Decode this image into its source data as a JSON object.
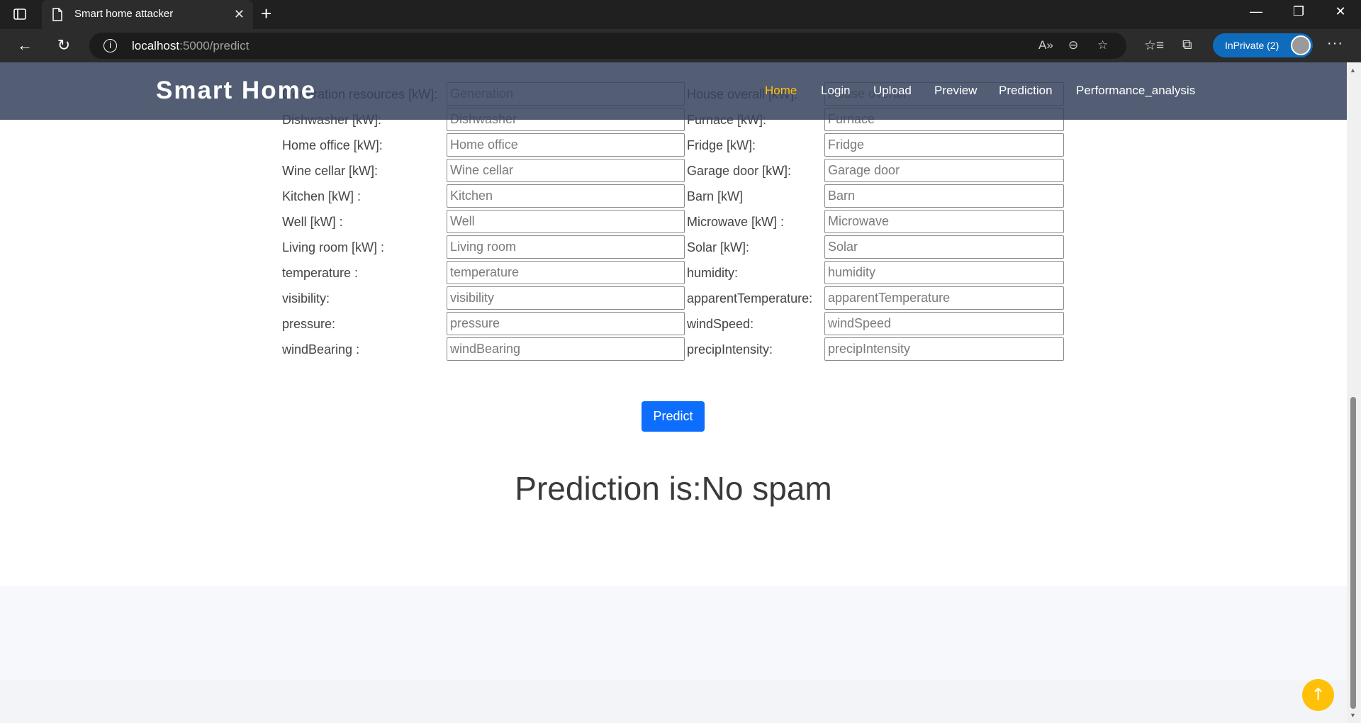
{
  "browser": {
    "tab_title": "Smart home attacker",
    "tab_close": "✕",
    "new_tab": "+",
    "url_host": "localhost",
    "url_path": ":5000/predict",
    "inprivate_label": "InPrivate (2)",
    "more": "···",
    "window_controls": [
      "—",
      "❐",
      "✕"
    ]
  },
  "navbar": {
    "brand": "Smart Home",
    "links": [
      "Home",
      "Login",
      "Upload",
      "Preview",
      "Prediction",
      "Performance_analysis"
    ],
    "active_link": "Home"
  },
  "form": {
    "rows": [
      {
        "left_label": "Generation resources [kW]:",
        "left_placeholder": "Generation",
        "right_label": "House overall [kW]:",
        "right_placeholder": "House overall"
      },
      {
        "left_label": "Dishwasher [kW]:",
        "left_placeholder": "Dishwasher",
        "right_label": "Furnace [kW]:",
        "right_placeholder": "Furnace"
      },
      {
        "left_label": "Home office [kW]:",
        "left_placeholder": "Home office",
        "right_label": "Fridge [kW]:",
        "right_placeholder": "Fridge"
      },
      {
        "left_label": "Wine cellar [kW]:",
        "left_placeholder": "Wine cellar",
        "right_label": "Garage door [kW]:",
        "right_placeholder": "Garage door"
      },
      {
        "left_label": "Kitchen [kW] :",
        "left_placeholder": "Kitchen",
        "right_label": "Barn [kW]",
        "right_placeholder": "Barn"
      },
      {
        "left_label": "Well [kW] :",
        "left_placeholder": "Well",
        "right_label": "Microwave [kW] :",
        "right_placeholder": "Microwave"
      },
      {
        "left_label": "Living room [kW] :",
        "left_placeholder": "Living room",
        "right_label": "Solar [kW]:",
        "right_placeholder": "Solar"
      },
      {
        "left_label": "temperature :",
        "left_placeholder": "temperature",
        "right_label": "humidity:",
        "right_placeholder": "humidity"
      },
      {
        "left_label": "visibility:",
        "left_placeholder": "visibility",
        "right_label": "apparentTemperature:",
        "right_placeholder": "apparentTemperature"
      },
      {
        "left_label": "pressure:",
        "left_placeholder": "pressure",
        "right_label": "windSpeed:",
        "right_placeholder": "windSpeed"
      },
      {
        "left_label": "windBearing :",
        "left_placeholder": "windBearing",
        "right_label": "precipIntensity:",
        "right_placeholder": "precipIntensity"
      }
    ],
    "submit_label": "Predict"
  },
  "result_text": "Prediction is:No spam",
  "back_to_top": "↑",
  "colors": {
    "navbar_bg": "#37445e",
    "active_link": "#ffc107",
    "predict_button": "#0d6efd",
    "back_to_top": "#ffc107"
  }
}
